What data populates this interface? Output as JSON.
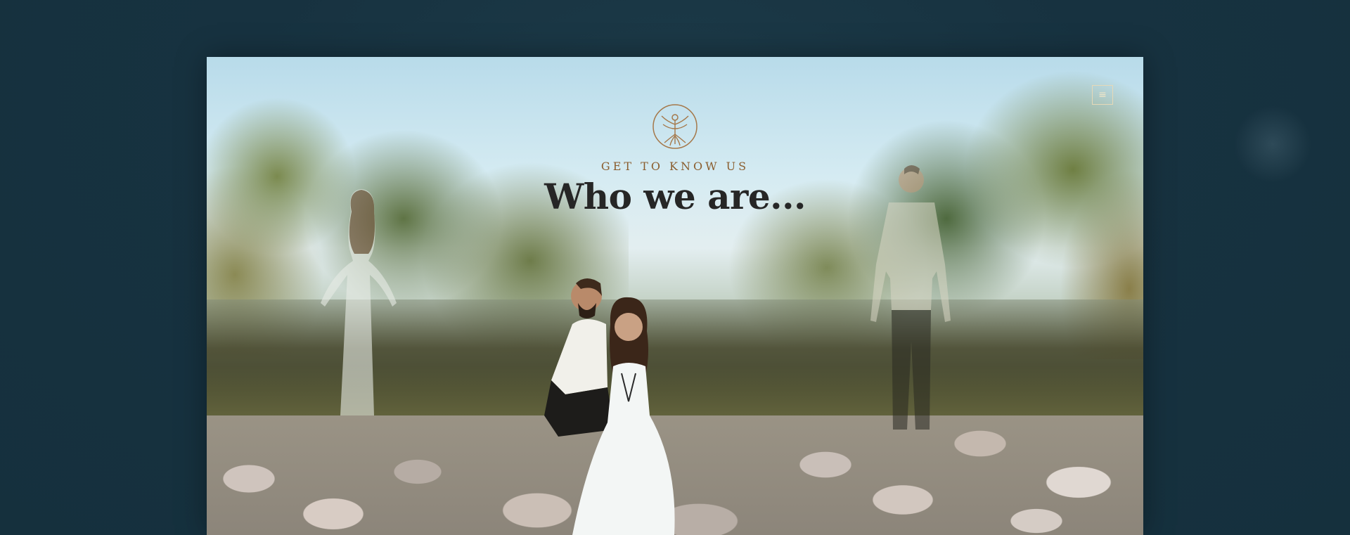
{
  "hero": {
    "eyebrow": "GET TO KNOW US",
    "headline": "Who we are..."
  },
  "menu": {
    "icon": "hamburger-menu-icon",
    "glyph": "≡"
  },
  "logo": {
    "icon": "tree-of-life-logo-icon"
  },
  "colors": {
    "page_background": "#173240",
    "eyebrow": "#8a5d2e",
    "headline": "#262626",
    "logo_stroke": "#a5784a",
    "menu_border": "#e6d9b8"
  }
}
